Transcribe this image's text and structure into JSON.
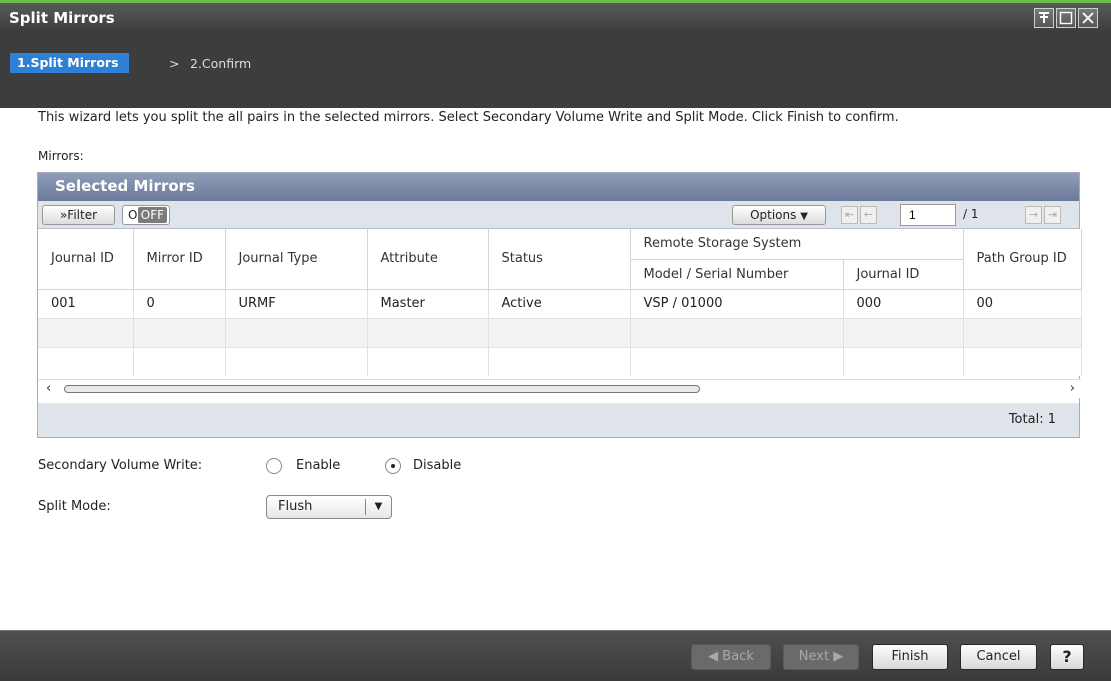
{
  "window": {
    "title": "Split Mirrors",
    "controls": [
      "pin-icon",
      "maximize-icon",
      "close-icon"
    ]
  },
  "steps": {
    "current": "1.Split Mirrors",
    "separator": ">",
    "next": "2.Confirm"
  },
  "description": "This wizard lets you split the all pairs in the selected mirrors. Select Secondary Volume Write and Split Mode. Click Finish to confirm.",
  "mirrors_label": "Mirrors:",
  "panel": {
    "title": "Selected Mirrors",
    "filter_label": "»Filter",
    "toggle_on": "ON",
    "toggle_off": "OFF",
    "options_label": "Options",
    "page_value": "1",
    "page_total": "/ 1",
    "columns": {
      "journal_id": "Journal ID",
      "mirror_id": "Mirror ID",
      "journal_type": "Journal Type",
      "attribute": "Attribute",
      "status": "Status",
      "remote_storage": "Remote Storage System",
      "model_serial": "Model / Serial Number",
      "remote_journal_id": "Journal ID",
      "path_group_id": "Path Group ID"
    },
    "rows": [
      {
        "journal_id": "001",
        "mirror_id": "0",
        "journal_type": "URMF",
        "attribute": "Master",
        "status": "Active",
        "model_serial": "VSP / 01000",
        "remote_journal_id": "000",
        "path_group_id": "00"
      }
    ],
    "total_label": "Total:",
    "total_value": "1"
  },
  "secondary_volume_write": {
    "label": "Secondary Volume Write:",
    "options": [
      "Enable",
      "Disable"
    ],
    "selected": "Disable"
  },
  "split_mode": {
    "label": "Split Mode:",
    "value": "Flush"
  },
  "footer": {
    "back": "Back",
    "next": "Next",
    "finish": "Finish",
    "cancel": "Cancel",
    "help": "?"
  }
}
